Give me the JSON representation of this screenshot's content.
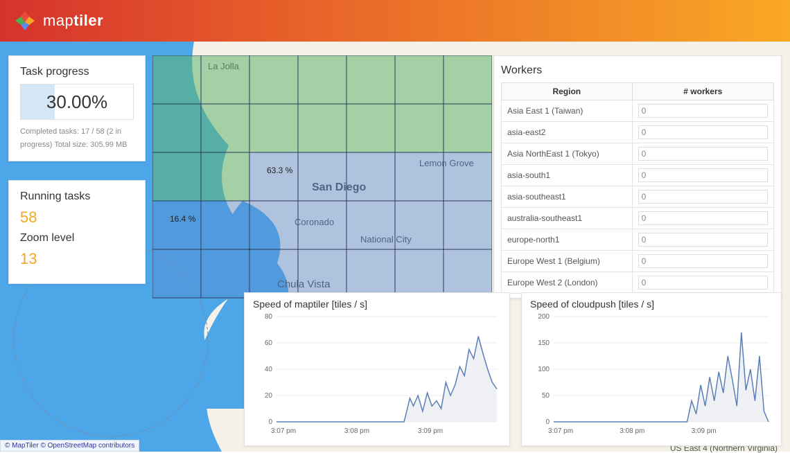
{
  "brand": {
    "name_prefix": "map",
    "name_bold": "tiler"
  },
  "task_progress": {
    "title": "Task progress",
    "percent_text": "30.00%",
    "percent_fill": 30,
    "meta": "Completed tasks: 17 / 58 (2 in progress) Total size: 305.99 MB"
  },
  "running": {
    "title": "Running tasks",
    "value": "58",
    "zoom_title": "Zoom level",
    "zoom_value": "13"
  },
  "grid_labels": {
    "a": "63.3 %",
    "b": "16.4 %"
  },
  "map_labels": {
    "sd": "San Diego",
    "coronado": "Coronado",
    "nc": "National City",
    "cv": "Chula Vista",
    "lg": "Lemon Grove",
    "lajolla": "La Jolla"
  },
  "workers": {
    "title": "Workers",
    "cols": {
      "region": "Region",
      "count": "# workers"
    },
    "rows": [
      {
        "region": "Asia East 1 (Taiwan)",
        "count": "0"
      },
      {
        "region": "asia-east2",
        "count": "0"
      },
      {
        "region": "Asia NorthEast 1 (Tokyo)",
        "count": "0"
      },
      {
        "region": "asia-south1",
        "count": "0"
      },
      {
        "region": "asia-southeast1",
        "count": "0"
      },
      {
        "region": "australia-southeast1",
        "count": "0"
      },
      {
        "region": "europe-north1",
        "count": "0"
      },
      {
        "region": "Europe West 1 (Belgium)",
        "count": "0"
      },
      {
        "region": "Europe West 2 (London)",
        "count": "0"
      }
    ],
    "cut_row": "US East 4 (Northern Virginia)"
  },
  "chart_data": [
    {
      "type": "area",
      "title": "Speed of maptiler [tiles / s]",
      "xlabel": "",
      "ylabel": "",
      "ylim": [
        0,
        80
      ],
      "yticks": [
        0,
        20,
        40,
        60,
        80
      ],
      "xticks": [
        "3:07 pm",
        "3:08 pm",
        "3:09 pm"
      ],
      "series": [
        {
          "name": "maptiler",
          "values": [
            [
              0,
              0
            ],
            [
              30,
              0
            ],
            [
              60,
              0
            ],
            [
              90,
              0
            ],
            [
              105,
              0
            ],
            [
              110,
              0
            ],
            [
              115,
              18
            ],
            [
              118,
              12
            ],
            [
              122,
              20
            ],
            [
              126,
              8
            ],
            [
              130,
              22
            ],
            [
              134,
              12
            ],
            [
              138,
              16
            ],
            [
              142,
              10
            ],
            [
              146,
              30
            ],
            [
              150,
              20
            ],
            [
              154,
              28
            ],
            [
              158,
              42
            ],
            [
              162,
              35
            ],
            [
              166,
              55
            ],
            [
              170,
              48
            ],
            [
              174,
              65
            ],
            [
              178,
              52
            ],
            [
              182,
              40
            ],
            [
              186,
              30
            ],
            [
              190,
              25
            ]
          ]
        }
      ]
    },
    {
      "type": "area",
      "title": "Speed of cloudpush [tiles / s]",
      "xlabel": "",
      "ylabel": "",
      "ylim": [
        0,
        200
      ],
      "yticks": [
        0,
        50,
        100,
        150,
        200
      ],
      "xticks": [
        "3:07 pm",
        "3:08 pm",
        "3:09 pm"
      ],
      "series": [
        {
          "name": "cloudpush",
          "values": [
            [
              0,
              0
            ],
            [
              40,
              0
            ],
            [
              80,
              0
            ],
            [
              110,
              0
            ],
            [
              118,
              0
            ],
            [
              122,
              40
            ],
            [
              126,
              15
            ],
            [
              130,
              70
            ],
            [
              134,
              30
            ],
            [
              138,
              85
            ],
            [
              142,
              40
            ],
            [
              146,
              95
            ],
            [
              150,
              55
            ],
            [
              154,
              125
            ],
            [
              158,
              80
            ],
            [
              162,
              30
            ],
            [
              166,
              170
            ],
            [
              170,
              60
            ],
            [
              174,
              100
            ],
            [
              178,
              40
            ],
            [
              182,
              125
            ],
            [
              186,
              20
            ],
            [
              190,
              0
            ]
          ]
        }
      ]
    }
  ],
  "attribution": "© MapTiler © OpenStreetMap contributors"
}
